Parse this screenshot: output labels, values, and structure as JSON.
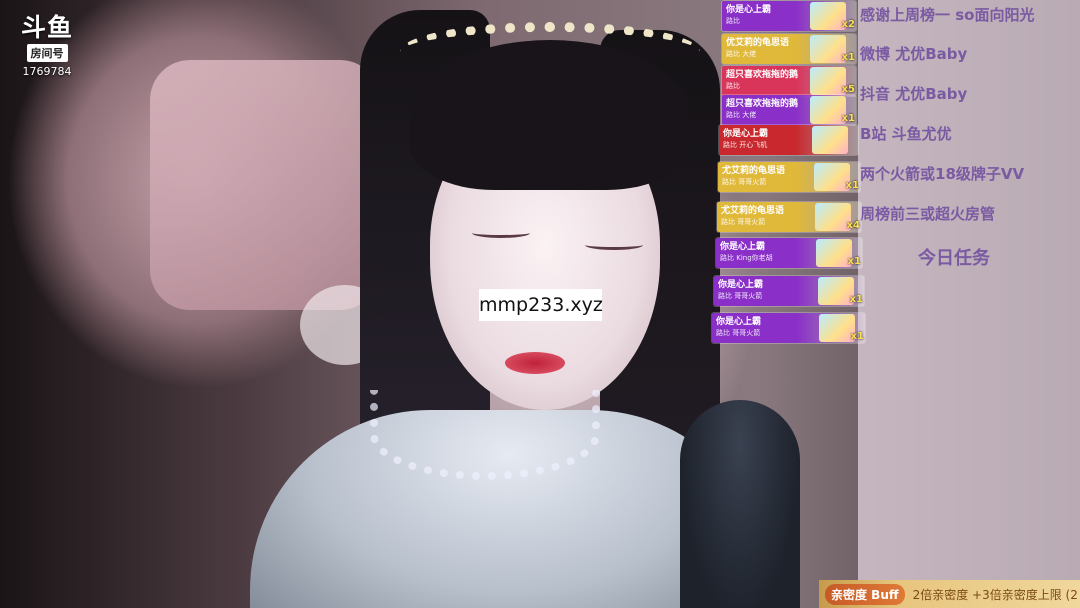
{
  "stream": {
    "platform_logo": "斗鱼",
    "room_tag": "房间号",
    "room_number": "1769784",
    "watermark": "mmp233.xyz"
  },
  "info_panel": {
    "lines": [
      "感谢上周榜一  so面向阳光",
      "微博  尤优Baby",
      "抖音  尤优Baby",
      "B站  斗鱼尤优",
      "两个火箭或18级牌子VV",
      "周榜前三或超火房管"
    ],
    "task_title": "今日任务"
  },
  "gift_cards": [
    {
      "title": "你是心上霸",
      "sub": "路比",
      "count": "x2",
      "color": "#8a2fc8"
    },
    {
      "title": "优艾莉的龟思语",
      "sub": "路比  大佬",
      "count": "x1",
      "color": "#e0b93a"
    },
    {
      "title": "超只喜欢拖拖的鹅",
      "sub": "路比",
      "count": "x5",
      "color": "#d9345a"
    },
    {
      "title": "超只喜欢拖拖的鹅",
      "sub": "路比  大佬",
      "count": "x1",
      "color": "#8a2fc8"
    },
    {
      "title": "你是心上霸",
      "sub": "路比  开心飞机",
      "count": "",
      "color": "#c8282e"
    },
    {
      "title": "尤艾莉的龟思语",
      "sub": "路比  哥哥火箭",
      "count": "x1",
      "color": "#e0b93a"
    },
    {
      "title": "尤艾莉的龟思语",
      "sub": "路比  哥哥火箭",
      "count": "x4",
      "color": "#e0b93a"
    },
    {
      "title": "你是心上霸",
      "sub": "路比  King你老胡",
      "count": "x1",
      "color": "#8a2fc8"
    },
    {
      "title": "你是心上霸",
      "sub": "路比  哥哥火箭",
      "count": "x1",
      "color": "#8a2fc8"
    },
    {
      "title": "你是心上霸",
      "sub": "路比  哥哥火箭",
      "count": "x1",
      "color": "#8a2fc8"
    }
  ],
  "buff_bar": {
    "label": "亲密度 Buff",
    "text": "2倍亲密度 +3倍亲密度上限 (2"
  },
  "colors": {
    "panel_text": "#7a5aa3",
    "buff_accent": "#c65a28"
  }
}
